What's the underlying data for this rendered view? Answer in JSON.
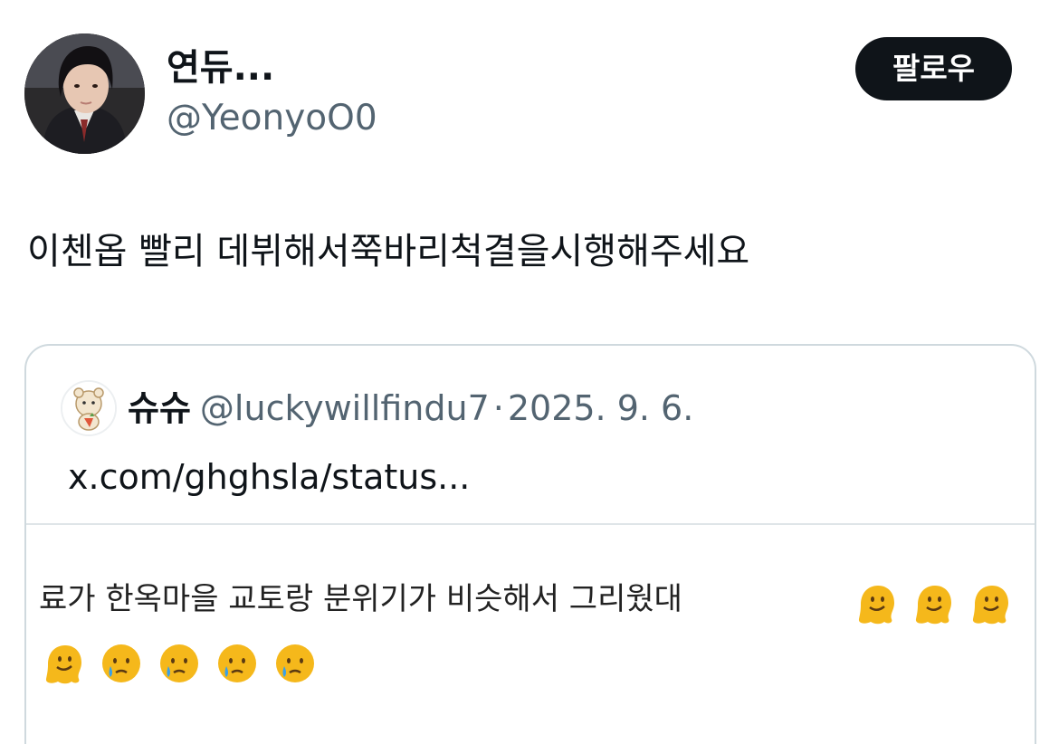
{
  "author": {
    "display_name": "연듀...",
    "handle": "@YeonyoO0",
    "avatar_icon": "profile-photo"
  },
  "follow_button": {
    "label": "팔로우"
  },
  "tweet": {
    "text": "이첸옵 빨리 데뷔해서쭉바리척결을시행해주세요"
  },
  "quote": {
    "display_name": "슈슈",
    "handle": "@luckywillfindu7",
    "separator": "·",
    "date": "2025. 9. 6.",
    "link_text": "x.com/ghghsla/status...",
    "avatar_icon": "cartoon-tiger-icon",
    "image": {
      "caption": "료가 한옥마을 교토랑 분위기가 비슷해서 그리웠대",
      "emojis": [
        "melting-face",
        "melting-face",
        "melting-face",
        "melting-face",
        "crying-face",
        "crying-face",
        "crying-face",
        "crying-face"
      ]
    }
  },
  "colors": {
    "text_primary": "#0f1419",
    "text_secondary": "#536471",
    "border": "#cfd9de",
    "button_bg": "#0f1419",
    "emoji_yellow": "#f5b81b"
  }
}
